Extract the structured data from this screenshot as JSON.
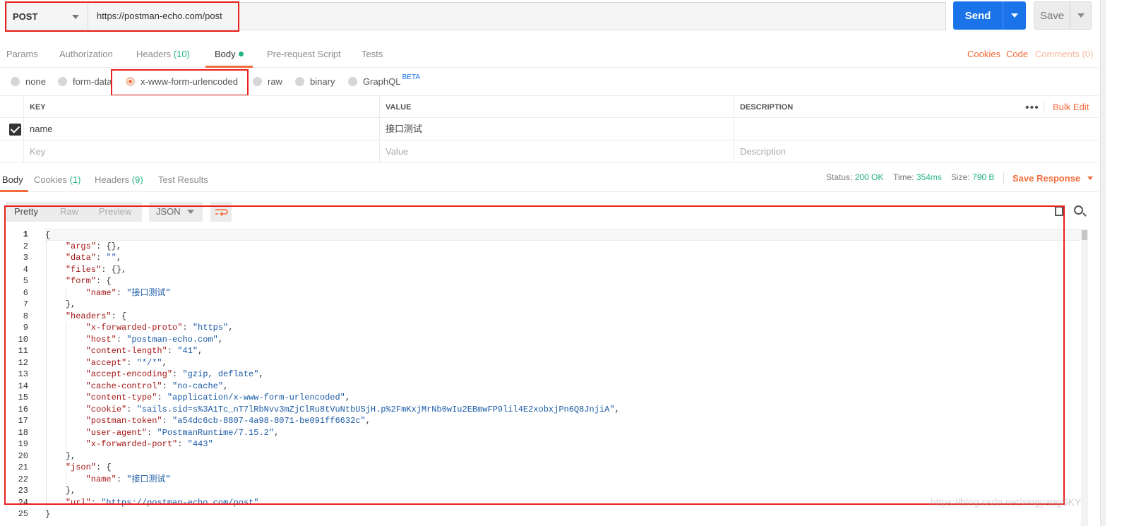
{
  "request": {
    "method": "POST",
    "url": "https://postman-echo.com/post",
    "send_label": "Send",
    "save_label": "Save"
  },
  "request_tabs": {
    "params": "Params",
    "authorization": "Authorization",
    "headers_label": "Headers",
    "headers_count": "(10)",
    "body": "Body",
    "prerequest": "Pre-request Script",
    "tests": "Tests",
    "cookies": "Cookies",
    "code": "Code",
    "comments": "Comments (0)"
  },
  "body_types": {
    "none": "none",
    "form_data": "form-data",
    "urlencoded": "x-www-form-urlencoded",
    "raw": "raw",
    "binary": "binary",
    "graphql": "GraphQL",
    "beta": "BETA",
    "selected": "x-www-form-urlencoded"
  },
  "params_table": {
    "headers": {
      "key": "KEY",
      "value": "VALUE",
      "description": "DESCRIPTION"
    },
    "bulk_edit": "Bulk Edit",
    "rows": [
      {
        "checked": true,
        "key": "name",
        "value": "接口测试",
        "description": ""
      }
    ],
    "placeholders": {
      "key": "Key",
      "value": "Value",
      "description": "Description"
    }
  },
  "response_tabs": {
    "body": "Body",
    "cookies_label": "Cookies",
    "cookies_count": "(1)",
    "headers_label": "Headers",
    "headers_count": "(9)",
    "test_results": "Test Results"
  },
  "response_status": {
    "status_label": "Status:",
    "status_value": "200 OK",
    "time_label": "Time:",
    "time_value": "354ms",
    "size_label": "Size:",
    "size_value": "790 B",
    "save_response": "Save Response"
  },
  "response_toolbar": {
    "pretty": "Pretty",
    "raw": "Raw",
    "preview": "Preview",
    "format": "JSON"
  },
  "response_body_lines": [
    "{",
    "    \"args\": {},",
    "    \"data\": \"\",",
    "    \"files\": {},",
    "    \"form\": {",
    "        \"name\": \"接口测试\"",
    "    },",
    "    \"headers\": {",
    "        \"x-forwarded-proto\": \"https\",",
    "        \"host\": \"postman-echo.com\",",
    "        \"content-length\": \"41\",",
    "        \"accept\": \"*/*\",",
    "        \"accept-encoding\": \"gzip, deflate\",",
    "        \"cache-control\": \"no-cache\",",
    "        \"content-type\": \"application/x-www-form-urlencoded\",",
    "        \"cookie\": \"sails.sid=s%3A1Tc_nT7lRbNvv3mZjClRu8tVuNtbUSjH.p%2FmKxjMrNb0wIu2EBmwFP9lil4E2xobxjPn6Q8JnjiA\",",
    "        \"postman-token\": \"a54dc6cb-8807-4a98-8071-be091ff6632c\",",
    "        \"user-agent\": \"PostmanRuntime/7.15.2\",",
    "        \"x-forwarded-port\": \"443\"",
    "    },",
    "    \"json\": {",
    "        \"name\": \"接口测试\"",
    "    },",
    "    \"url\": \"https://postman-echo.com/post\"",
    "}"
  ],
  "watermark": "https://blog.csdn.net/xingyangSKY"
}
